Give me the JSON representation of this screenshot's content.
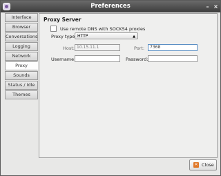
{
  "window": {
    "title": "Preferences",
    "minimize_glyph": "–",
    "close_glyph": "×"
  },
  "sidebar": {
    "items": [
      {
        "label": "Interface"
      },
      {
        "label": "Browser"
      },
      {
        "label": "Conversations"
      },
      {
        "label": "Logging"
      },
      {
        "label": "Network"
      },
      {
        "label": "Proxy",
        "active": true
      },
      {
        "label": "Sounds"
      },
      {
        "label": "Status / Idle"
      },
      {
        "label": "Themes"
      }
    ]
  },
  "proxy": {
    "section_title": "Proxy Server",
    "remote_dns_label": "Use remote DNS with SOCKS4 proxies",
    "remote_dns_checked": false,
    "type_label": "Proxy type:",
    "type_value": "HTTP",
    "host_label": "Host:",
    "host_value": "10.15.11.1",
    "port_label": "Port:",
    "port_value": "7368",
    "username_label": "Username:",
    "username_value": "",
    "password_label": "Password:",
    "password_value": ""
  },
  "footer": {
    "close_label": "Close"
  }
}
